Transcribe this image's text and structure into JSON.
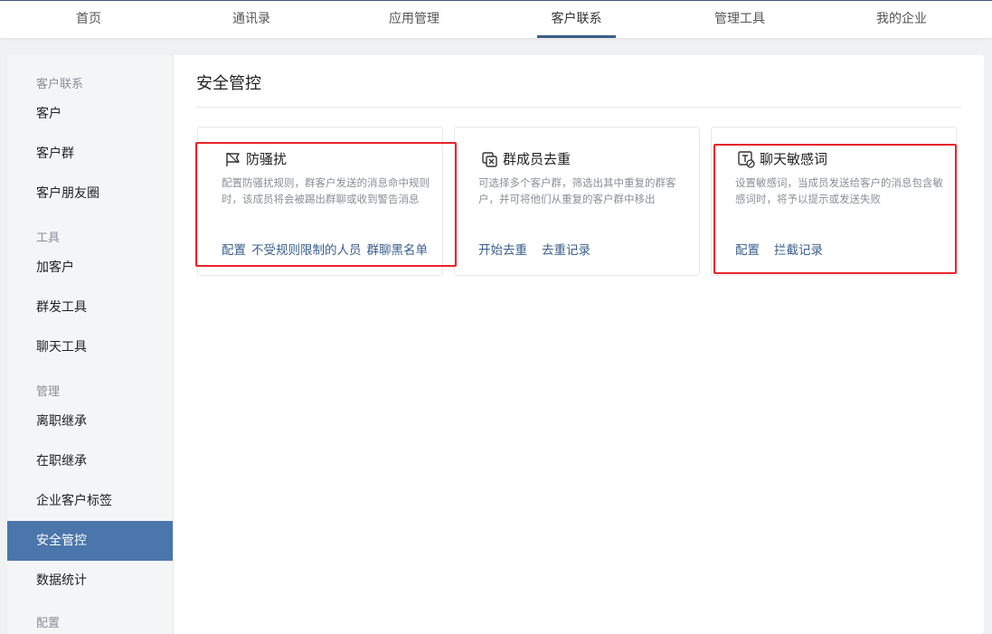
{
  "topnav": {
    "tabs": [
      {
        "label": "首页"
      },
      {
        "label": "通讯录"
      },
      {
        "label": "应用管理"
      },
      {
        "label": "客户联系"
      },
      {
        "label": "管理工具"
      },
      {
        "label": "我的企业"
      }
    ],
    "active": "客户联系"
  },
  "sidebar": {
    "groups": [
      {
        "label": "客户联系",
        "items": [
          "客户",
          "客户群",
          "客户朋友圈"
        ]
      },
      {
        "label": "工具",
        "items": [
          "加客户",
          "群发工具",
          "聊天工具"
        ]
      },
      {
        "label": "管理",
        "items": [
          "离职继承",
          "在职继承",
          "企业客户标签",
          "安全管控",
          "数据统计"
        ]
      },
      {
        "label": "配置",
        "items": []
      }
    ],
    "active_item": "安全管控"
  },
  "page": {
    "title": "安全管控"
  },
  "cards": [
    {
      "title": "防骚扰",
      "icon": "flag-icon",
      "desc": "配置防骚扰规则，群客户发送的消息命中规则时，该成员将会被踢出群聊或收到警告消息",
      "actions": [
        "配置",
        "不受规则限制的人员",
        "群聊黑名单"
      ]
    },
    {
      "title": "群成员去重",
      "icon": "dedupe-icon",
      "desc": "可选择多个客户群，筛选出其中重复的群客户，并可将他们从重复的客户群中移出",
      "actions": [
        "开始去重",
        "去重记录"
      ]
    },
    {
      "title": "聊天敏感词",
      "icon": "sensitive-word-icon",
      "desc": "设置敏感词，当成员发送给客户的消息包含敏感词时，将予以提示或发送失败",
      "actions": [
        "配置",
        "拦截记录"
      ]
    }
  ],
  "colors": {
    "accent": "#4a76ab",
    "link": "#3a5f8c",
    "highlight": "#e8232a"
  }
}
